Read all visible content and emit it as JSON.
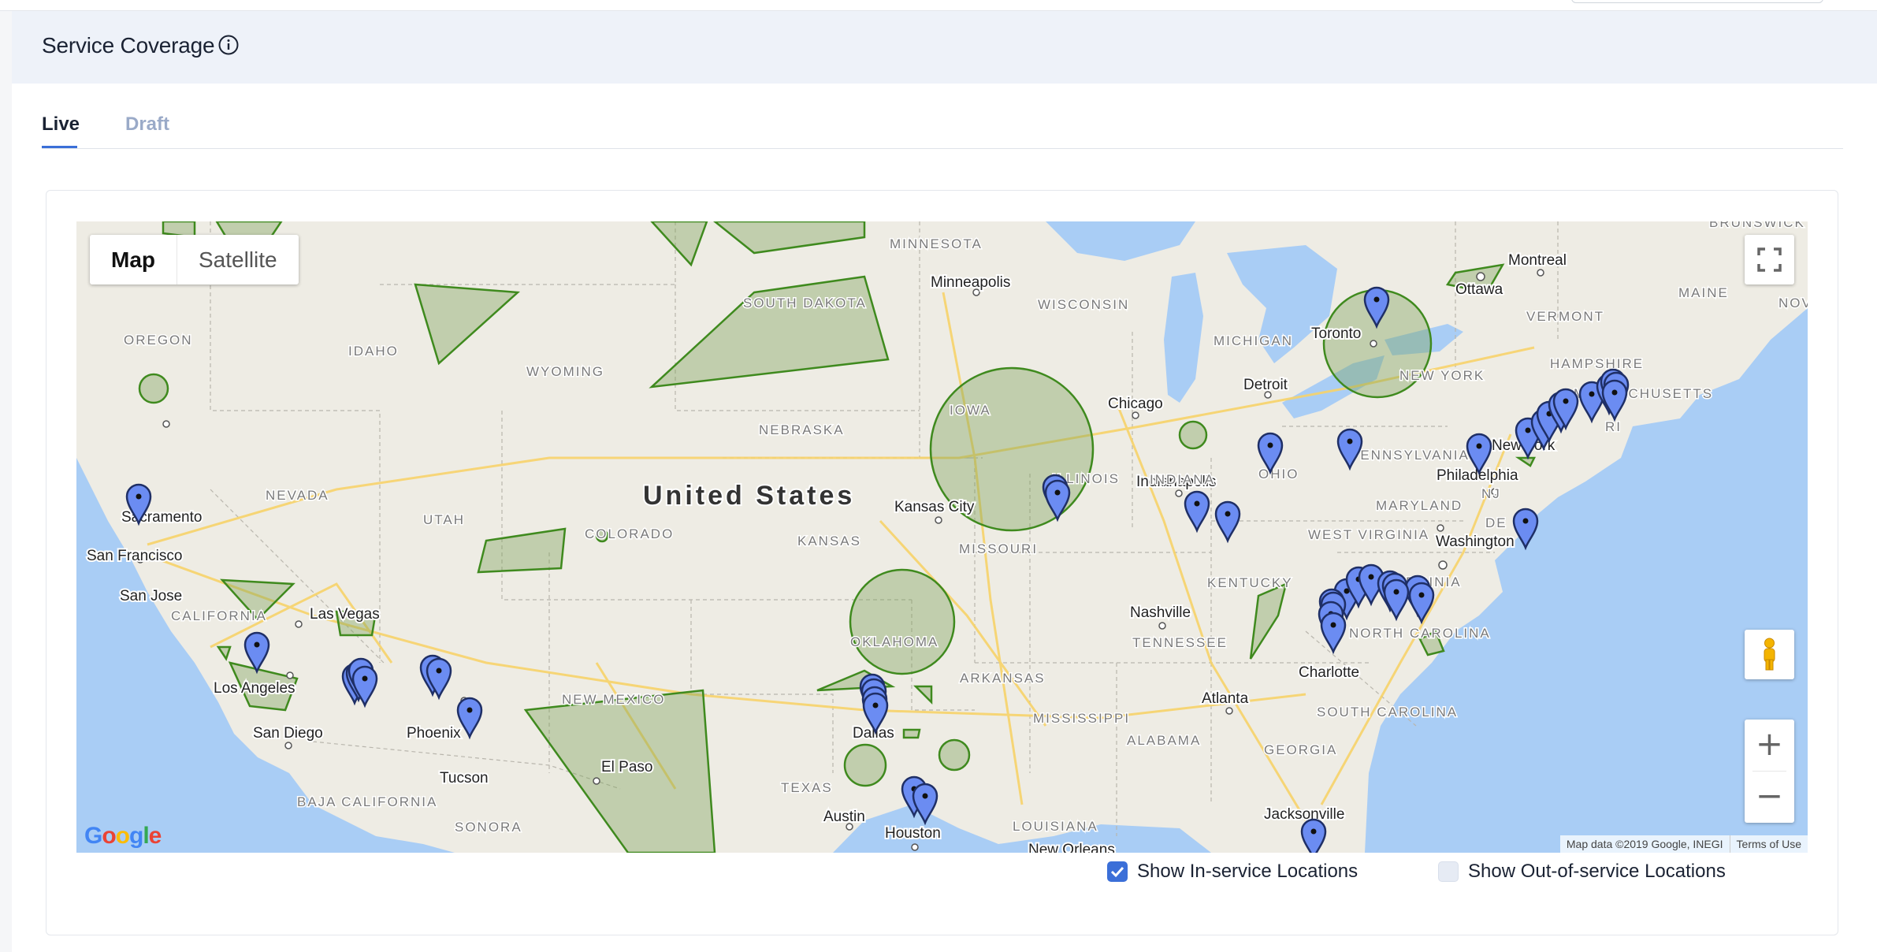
{
  "panel": {
    "title": "Service Coverage",
    "info_icon": "info-circle-icon"
  },
  "tabs": [
    {
      "label": "Live",
      "active": true
    },
    {
      "label": "Draft",
      "active": false
    }
  ],
  "map": {
    "type_controls": {
      "map_label": "Map",
      "satellite_label": "Satellite",
      "selected": "Map"
    },
    "country_label": "United States",
    "cities": [
      {
        "name": "Minneapolis"
      },
      {
        "name": "Montreal"
      },
      {
        "name": "Ottawa"
      },
      {
        "name": "Toronto"
      },
      {
        "name": "Detroit"
      },
      {
        "name": "Chicago"
      },
      {
        "name": "Kansas City"
      },
      {
        "name": "Indianapolis"
      },
      {
        "name": "New York"
      },
      {
        "name": "Philadelphia"
      },
      {
        "name": "Washington"
      },
      {
        "name": "Nashville"
      },
      {
        "name": "Charlotte"
      },
      {
        "name": "Atlanta"
      },
      {
        "name": "Jacksonville"
      },
      {
        "name": "Sacramento"
      },
      {
        "name": "San Francisco"
      },
      {
        "name": "San Jose"
      },
      {
        "name": "Las Vegas"
      },
      {
        "name": "Los Angeles"
      },
      {
        "name": "San Diego"
      },
      {
        "name": "Phoenix"
      },
      {
        "name": "Tucson"
      },
      {
        "name": "El Paso"
      },
      {
        "name": "Dallas"
      },
      {
        "name": "Austin"
      },
      {
        "name": "Houston"
      },
      {
        "name": "New Orleans"
      }
    ],
    "regions": [
      {
        "name": "OREGON"
      },
      {
        "name": "IDAHO"
      },
      {
        "name": "WYOMING"
      },
      {
        "name": "MINNESOTA"
      },
      {
        "name": "SOUTH DAKOTA"
      },
      {
        "name": "WISCONSIN"
      },
      {
        "name": "MICHIGAN"
      },
      {
        "name": "NEBRASKA"
      },
      {
        "name": "IOWA"
      },
      {
        "name": "ILLINOIS"
      },
      {
        "name": "INDIANA"
      },
      {
        "name": "OHIO"
      },
      {
        "name": "PENNSYLVANIA"
      },
      {
        "name": "NEW YORK"
      },
      {
        "name": "VERMONT"
      },
      {
        "name": "MAINE"
      },
      {
        "name": "NEVADA"
      },
      {
        "name": "UTAH"
      },
      {
        "name": "COLORADO"
      },
      {
        "name": "KANSAS"
      },
      {
        "name": "MISSOURI"
      },
      {
        "name": "KENTUCKY"
      },
      {
        "name": "WEST VIRGINIA"
      },
      {
        "name": "VIRGINIA"
      },
      {
        "name": "MARYLAND"
      },
      {
        "name": "CALIFORNIA"
      },
      {
        "name": "OKLAHOMA"
      },
      {
        "name": "ARKANSAS"
      },
      {
        "name": "TENNESSEE"
      },
      {
        "name": "NORTH CAROLINA"
      },
      {
        "name": "SOUTH CAROLINA"
      },
      {
        "name": "NEW MEXICO"
      },
      {
        "name": "TEXAS"
      },
      {
        "name": "MISSISSIPPI"
      },
      {
        "name": "ALABAMA"
      },
      {
        "name": "GEORGIA"
      },
      {
        "name": "LOUISIANA"
      },
      {
        "name": "BAJA CALIFORNIA"
      },
      {
        "name": "SONORA"
      },
      {
        "name": "NJ"
      },
      {
        "name": "DE"
      },
      {
        "name": "RI"
      },
      {
        "name": "BRUNSWICK"
      },
      {
        "name": "NOV"
      },
      {
        "name": "MASSACHUSETTS"
      },
      {
        "name": "HAMPSHIRE"
      }
    ],
    "attribution": {
      "map_data": "Map data ©2019 Google, INEGI",
      "terms": "Terms of Use"
    },
    "logo": "Google",
    "controls": {
      "fullscreen_icon": "fullscreen-icon",
      "pegman_icon": "pegman-icon",
      "zoom_in": "+",
      "zoom_out": "−"
    },
    "colors": {
      "water": "#a9cdf5",
      "land": "#eeece4",
      "coverage_fill": "#7da35a",
      "coverage_stroke": "#3f8a1e",
      "marker": "#6b8cf2"
    }
  },
  "legend": {
    "in_service": {
      "label": "Show In-service Locations",
      "checked": true
    },
    "out_of_service": {
      "label": "Show Out-of-service Locations",
      "checked": false
    }
  }
}
